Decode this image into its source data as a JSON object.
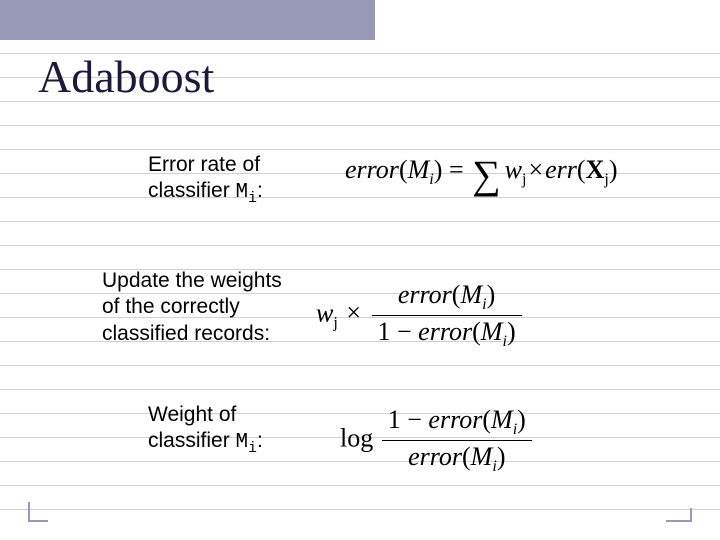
{
  "title": "Adaboost",
  "row1": {
    "label_a": "Error rate of",
    "label_b": "classifier ",
    "sym": "M",
    "sub": "i",
    "suffix": ":"
  },
  "row2": {
    "label_a": "Update the weights",
    "label_b": "of the correctly",
    "label_c": "classified records:"
  },
  "row3": {
    "label_a": "Weight of",
    "label_b": "classifier ",
    "sym": "M",
    "sub": "i",
    "suffix": ":"
  },
  "f1": {
    "lhs": "error",
    "M": "M",
    "i": "i",
    "eq": " = ",
    "w": "w",
    "j1": "j",
    "err": "err",
    "X": "X",
    "j2": "j"
  },
  "f2": {
    "w": "w",
    "j": "j",
    "err": "error",
    "M": "M",
    "i": "i",
    "one": "1"
  },
  "f3": {
    "log": "log",
    "one": "1",
    "err": "error",
    "M": "M",
    "i": "i"
  }
}
